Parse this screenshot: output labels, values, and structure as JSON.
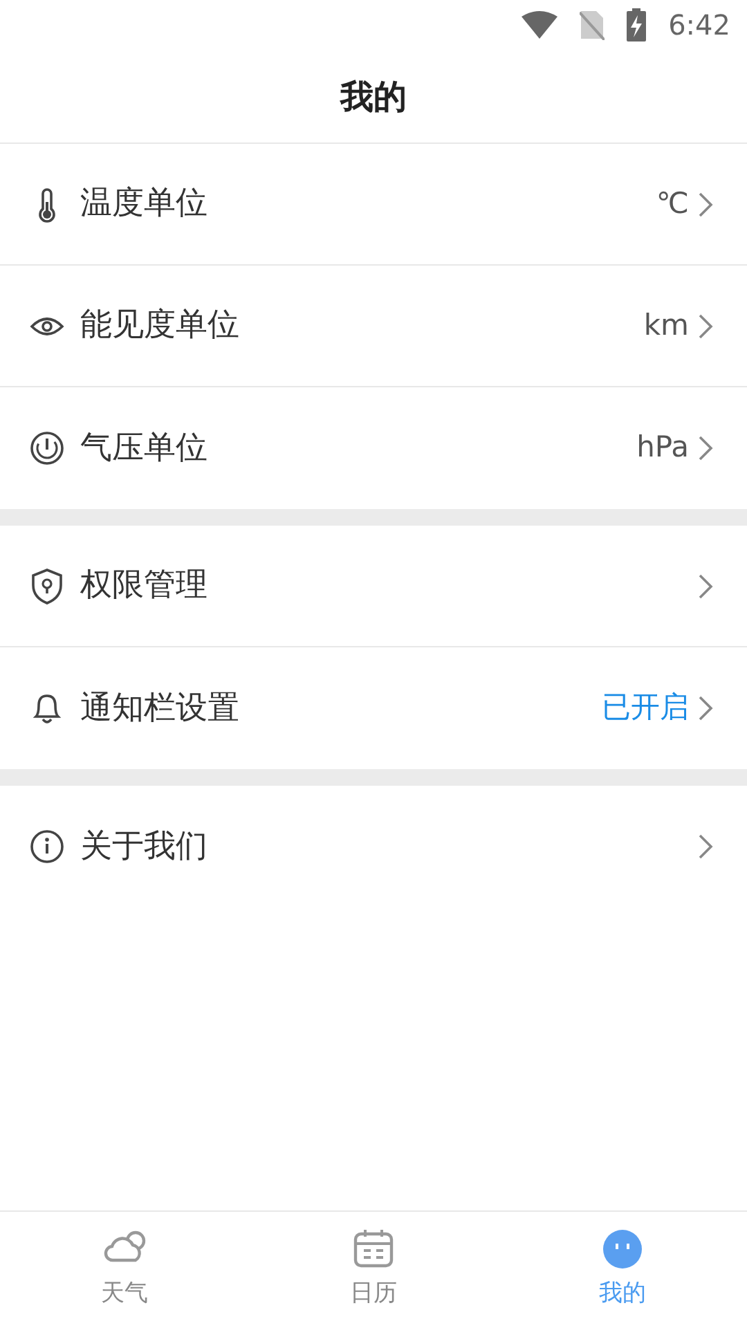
{
  "status_bar": {
    "time": "6:42"
  },
  "header": {
    "title": "我的"
  },
  "groups": [
    {
      "items": [
        {
          "label": "温度单位",
          "value": "℃",
          "highlighted": false
        },
        {
          "label": "能见度单位",
          "value": "km",
          "highlighted": false
        },
        {
          "label": "气压单位",
          "value": "hPa",
          "highlighted": false
        }
      ]
    },
    {
      "items": [
        {
          "label": "权限管理"
        },
        {
          "label": "通知栏设置",
          "value": "已开启",
          "highlighted": true
        }
      ]
    },
    {
      "items": [
        {
          "label": "关于我们"
        }
      ]
    }
  ],
  "tabs": [
    {
      "label": "天气",
      "selected": false
    },
    {
      "label": "日历",
      "selected": false
    },
    {
      "label": "我的",
      "selected": true
    }
  ]
}
